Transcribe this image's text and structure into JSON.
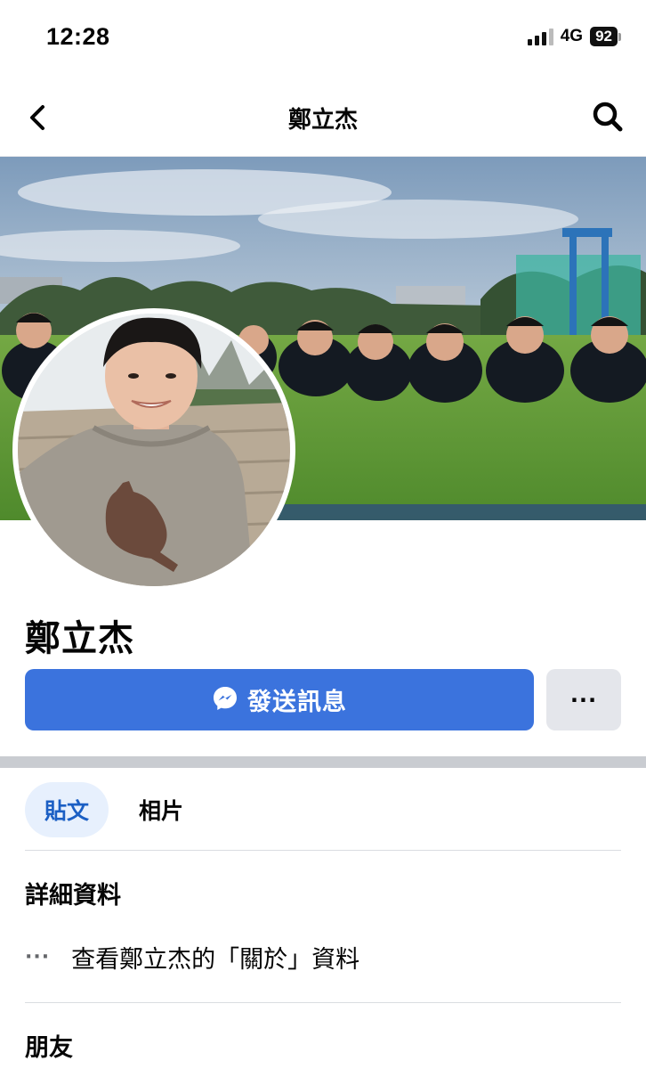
{
  "status_bar": {
    "time": "12:28",
    "network": "4G",
    "battery": "92"
  },
  "nav": {
    "title": "鄭立杰",
    "back_icon": "chevron-left-icon",
    "search_icon": "search-icon"
  },
  "profile": {
    "name": "鄭立杰"
  },
  "actions": {
    "message_label": "發送訊息",
    "message_icon": "messenger-icon",
    "more_label": "···"
  },
  "tabs": [
    {
      "label": "貼文",
      "active": true
    },
    {
      "label": "相片",
      "active": false
    }
  ],
  "details": {
    "heading": "詳細資料",
    "about_dots": "···",
    "about_text": "查看鄭立杰的「關於」資料"
  },
  "friends": {
    "heading": "朋友"
  },
  "colors": {
    "primary_button": "#3b73dd",
    "active_tab_bg": "#e7f0fd",
    "active_tab_text": "#1b5fc4",
    "secondary_button": "#e4e6eb",
    "divider": "#c9ccd1"
  }
}
